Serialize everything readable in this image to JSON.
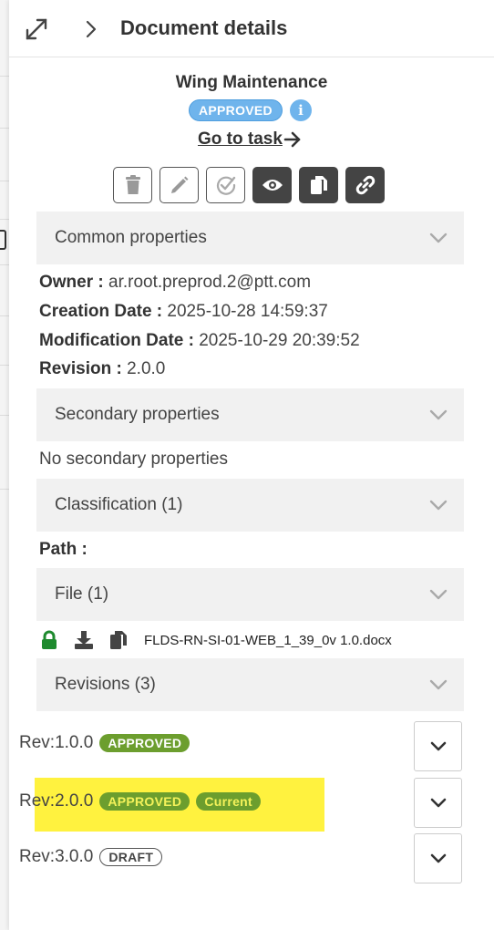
{
  "header": {
    "title": "Document details",
    "expand_icon": "expand-arrows-icon",
    "collapse_icon": "chevron-right-icon"
  },
  "document": {
    "name": "Wing Maintenance",
    "status": "APPROVED",
    "go_to_task": "Go to task"
  },
  "toolbar": {
    "buttons": [
      {
        "name": "delete-button",
        "icon": "trash-icon"
      },
      {
        "name": "edit-button",
        "icon": "pencil-icon"
      },
      {
        "name": "sign-button",
        "icon": "check-circle-icon"
      },
      {
        "name": "preview-button",
        "icon": "eye-icon"
      },
      {
        "name": "copy-button",
        "icon": "copy-icon"
      },
      {
        "name": "link-button",
        "icon": "link-icon"
      }
    ]
  },
  "sections": {
    "common": "Common properties",
    "secondary": "Secondary properties",
    "classification": "Classification (1)",
    "file": "File (1)",
    "revisions": "Revisions (3)"
  },
  "properties": {
    "owner_label": "Owner :",
    "owner_value": "ar.root.preprod.2@ptt.com",
    "creation_label": "Creation Date :",
    "creation_value": "2025-10-28 14:59:37",
    "modification_label": "Modification Date :",
    "modification_value": "2025-10-29 20:39:52",
    "revision_label": "Revision :",
    "revision_value": "2.0.0"
  },
  "secondary": {
    "empty_text": "No secondary properties"
  },
  "classification": {
    "path_label": "Path :"
  },
  "file": {
    "name": "FLDS-RN-SI-01-WEB_1_39_0v 1.0.docx",
    "lock_color": "#1e8a2e"
  },
  "revisions": [
    {
      "label": "Rev:1.0.0",
      "status": "APPROVED",
      "current": null,
      "highlighted": false
    },
    {
      "label": "Rev:2.0.0",
      "status": "APPROVED",
      "current": "Current",
      "highlighted": true
    },
    {
      "label": "Rev:3.0.0",
      "status": "DRAFT",
      "current": null,
      "highlighted": false
    }
  ],
  "colors": {
    "approved_badge": "#6fb4ec",
    "green_badge": "#6c9e2e",
    "highlight": "#fff23f",
    "dark_button": "#444444"
  }
}
